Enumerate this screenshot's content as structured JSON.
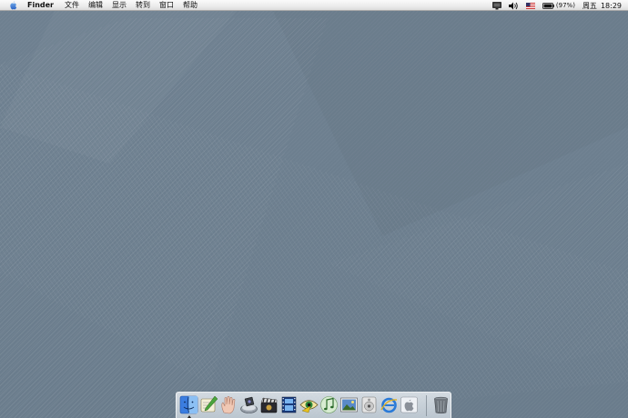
{
  "menubar": {
    "app_name": "Finder",
    "menus": [
      "文件",
      "编辑",
      "显示",
      "转到",
      "窗口",
      "帮助"
    ],
    "battery_percent": "(97%)",
    "clock_day": "周五",
    "clock_time": "18:29",
    "status_icons": [
      "display-icon",
      "volume-icon",
      "us-flag-icon",
      "battery-icon"
    ]
  },
  "dock": {
    "apps": [
      "finder-icon",
      "chat-pen-icon",
      "hand-icon",
      "scanner-icon",
      "movie-clapper-icon",
      "film-strip-icon",
      "eye-icon",
      "music-note-icon",
      "photo-icon",
      "disc-icon",
      "internet-explorer-icon",
      "apple-logo-icon"
    ],
    "trash": "trash-icon"
  },
  "colors": {
    "desktop_base": "#6f8191",
    "menubar": "#ececec",
    "dock": "#d6dde3"
  }
}
